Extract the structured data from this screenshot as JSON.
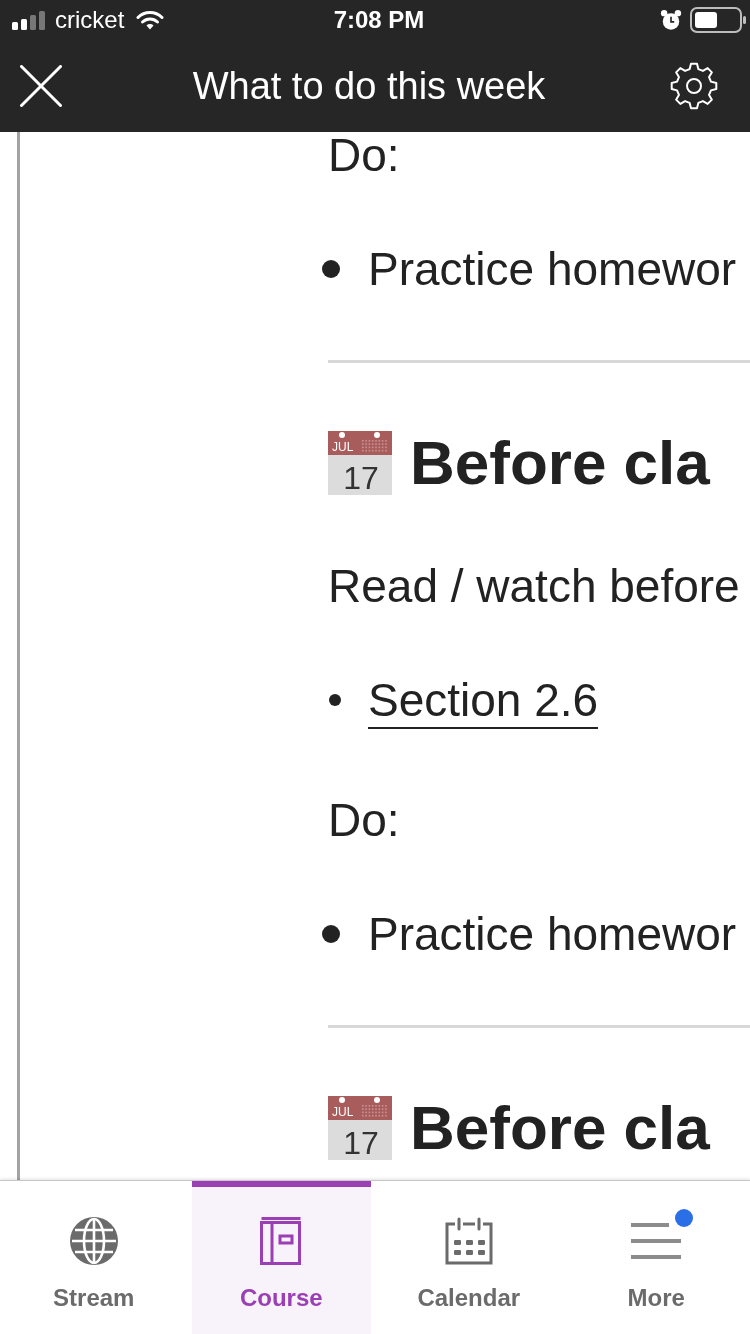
{
  "status_bar": {
    "carrier": "cricket",
    "time": "7:08 PM"
  },
  "header": {
    "title": "What to do this week"
  },
  "content": [
    {
      "kind": "paragraph",
      "text": "Do:"
    },
    {
      "kind": "list",
      "items": [
        {
          "kind": "text",
          "text": "Practice homewor"
        }
      ]
    },
    {
      "kind": "divider"
    },
    {
      "kind": "heading",
      "icon_month": "JUL",
      "icon_day": "17",
      "text": "Before cla"
    },
    {
      "kind": "paragraph",
      "text": "Read / watch before"
    },
    {
      "kind": "list",
      "items": [
        {
          "kind": "link",
          "text": "Section 2.6"
        }
      ]
    },
    {
      "kind": "paragraph",
      "text": "Do:"
    },
    {
      "kind": "list",
      "items": [
        {
          "kind": "text",
          "text": "Practice homewor"
        }
      ]
    },
    {
      "kind": "divider"
    },
    {
      "kind": "heading",
      "icon_month": "JUL",
      "icon_day": "17",
      "text": "Before cla"
    }
  ],
  "tab_bar": {
    "tabs": [
      {
        "label": "Stream",
        "selected": false,
        "notification": false
      },
      {
        "label": "Course",
        "selected": true,
        "notification": false
      },
      {
        "label": "Calendar",
        "selected": false,
        "notification": false
      },
      {
        "label": "More",
        "selected": false,
        "notification": true
      }
    ]
  }
}
